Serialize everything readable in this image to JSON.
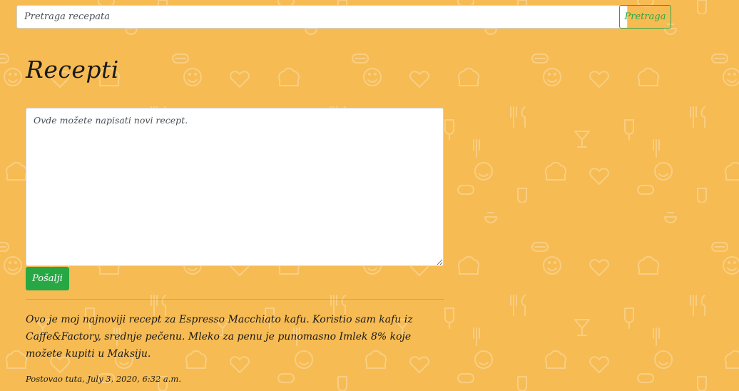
{
  "search": {
    "placeholder": "Pretraga recepata",
    "button_label": "Pretraga"
  },
  "main": {
    "title": "Recepti",
    "textarea_placeholder": "Ovde možete napisati novi recept.",
    "submit_label": "Pošalji"
  },
  "posts": [
    {
      "body": "Ovo je moj najnoviji recept za Espresso Macchiato kafu. Koristio sam kafu iz Caffe&Factory, srednje pečenu. Mleko za penu je punomasno Imlek 8% koje možete kupiti u Maksiju.",
      "meta": "Postovao tuta, July 3, 2020, 6:32 a.m."
    }
  ],
  "colors": {
    "background": "#f6bb53",
    "accent_green": "#28a745"
  },
  "background_icons": [
    "heart-icon",
    "smiley-icon",
    "chef-hat-icon",
    "fork-knife-icon",
    "hotdog-icon",
    "popsicle-icon",
    "cocktail-icon",
    "teapot-icon"
  ]
}
